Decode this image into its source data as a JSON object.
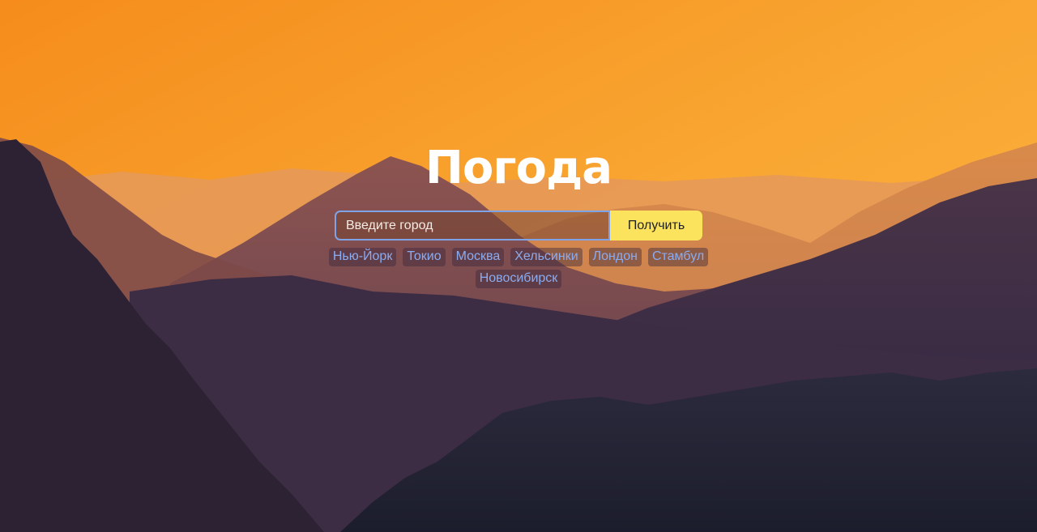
{
  "app": {
    "title": "Погода"
  },
  "search": {
    "placeholder": "Введите город",
    "value": "",
    "button_label": "Получить"
  },
  "quick_cities": [
    "Нью-Йорк",
    "Токио",
    "Москва",
    "Хельсинки",
    "Лондон",
    "Стамбул",
    "Новосибирск"
  ],
  "colors": {
    "button_bg": "#fce35e",
    "input_border": "#7ea3e6",
    "chip_text": "#8aacf2",
    "title_text": "#ffffff"
  }
}
